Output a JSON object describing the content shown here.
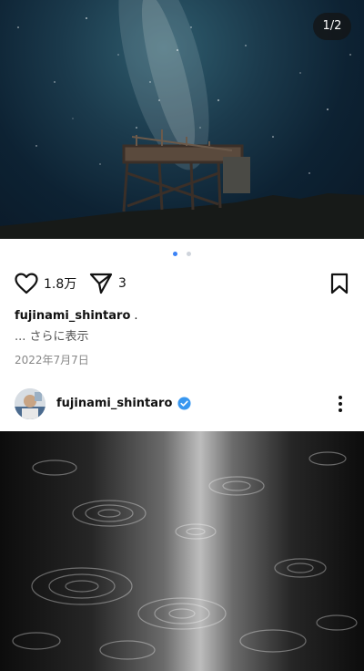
{
  "post1": {
    "page_indicator": "1/2",
    "carousel": {
      "total": 2,
      "active_index": 0
    },
    "likes_count": "1.8万",
    "shares_count": "3",
    "caption_username": "fujinami_shintaro",
    "caption_suffix": ".",
    "more_label": "... さらに表示",
    "date": "2022年7月7日"
  },
  "post2": {
    "username": "fujinami_shintaro",
    "verified": true
  },
  "icons": {
    "like": "heart-icon",
    "share": "send-icon",
    "save": "bookmark-icon",
    "verified": "verified-badge-icon",
    "more": "more-vertical-icon"
  },
  "colors": {
    "accent": "#3b82f6",
    "verified": "#3897f0",
    "text_primary": "#111111",
    "text_secondary": "#555555",
    "text_muted": "#888888"
  }
}
